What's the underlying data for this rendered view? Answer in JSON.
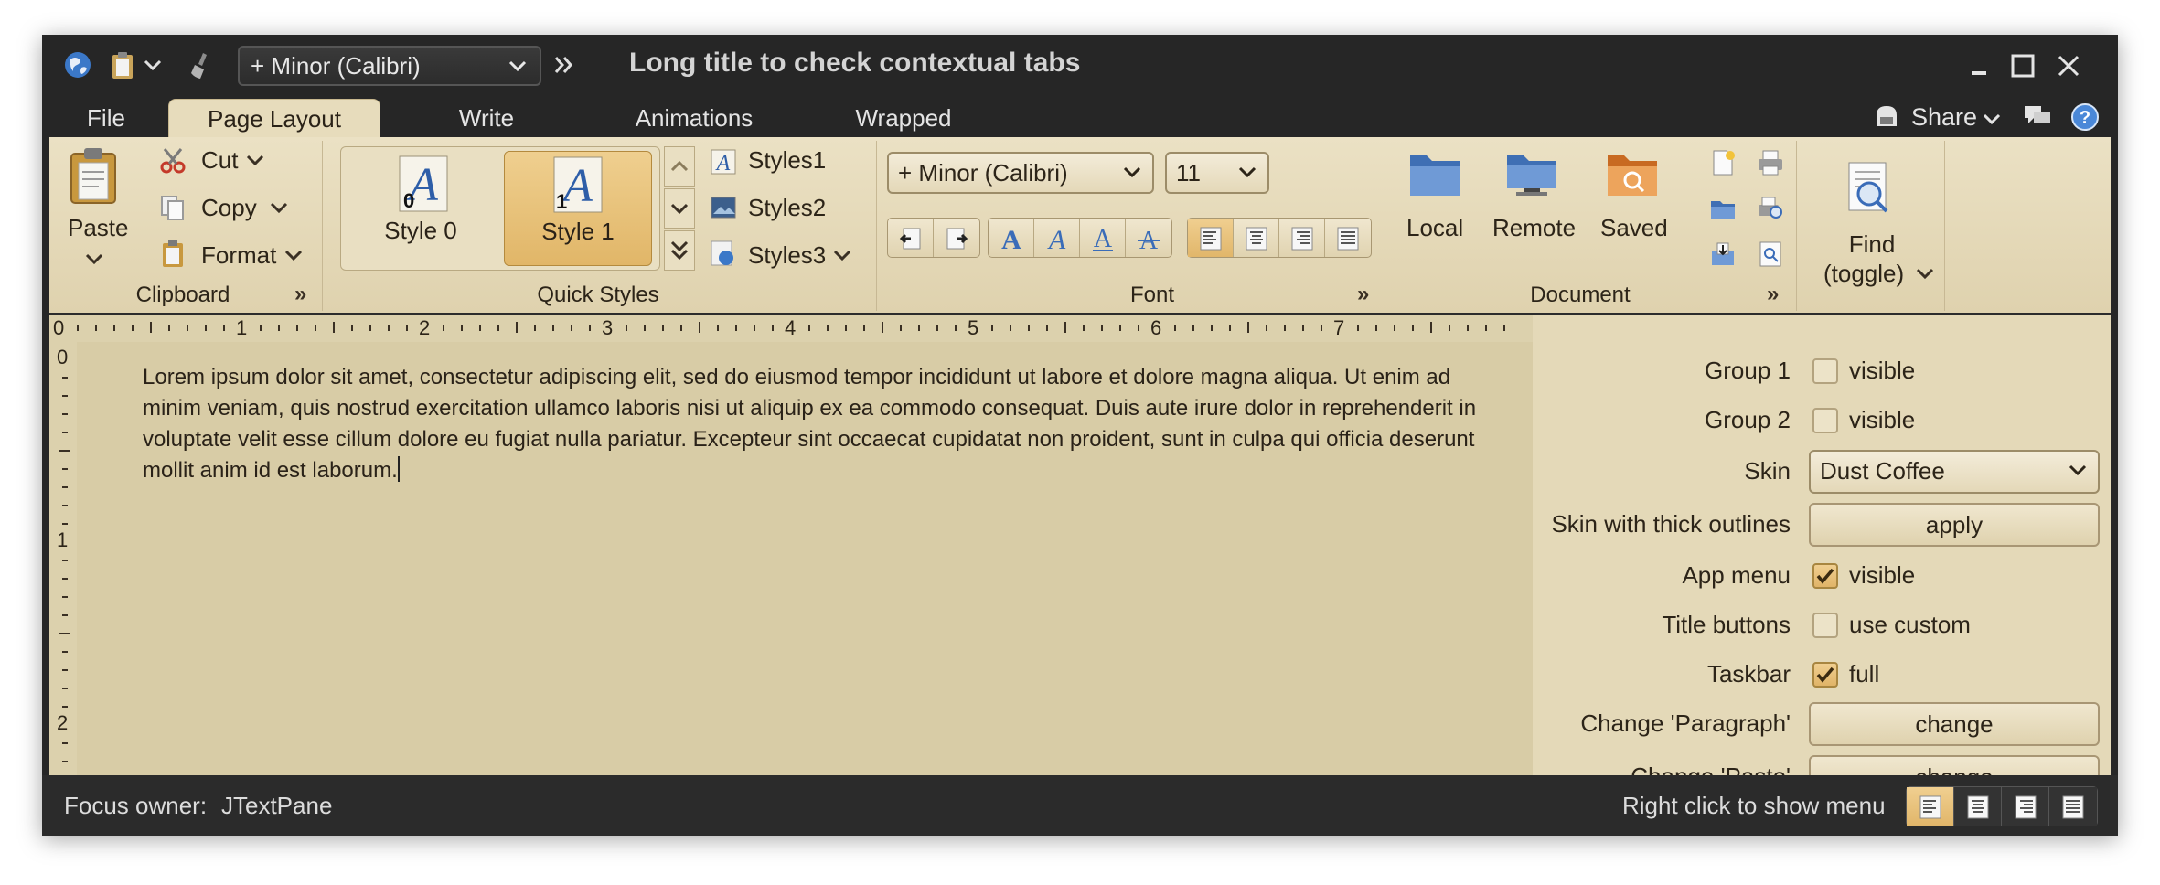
{
  "title_bar": {
    "font_combo": "+ Minor (Calibri)",
    "title": "Long title to check contextual tabs"
  },
  "tabs": [
    {
      "label": "File"
    },
    {
      "label": "Page Layout"
    },
    {
      "label": "Write"
    },
    {
      "label": "Animations"
    },
    {
      "label": "Wrapped"
    }
  ],
  "share_label": "Share",
  "ribbon": {
    "clipboard": {
      "title": "Clipboard",
      "paste": "Paste",
      "cut": "Cut",
      "copy": "Copy",
      "format": "Format"
    },
    "quick_styles": {
      "title": "Quick Styles",
      "style0": "Style 0",
      "style0_num": "0",
      "style1": "Style 1",
      "style1_num": "1",
      "styles1": "Styles1",
      "styles2": "Styles2",
      "styles3": "Styles3"
    },
    "font": {
      "title": "Font",
      "family": "+ Minor (Calibri)",
      "size": "11"
    },
    "document": {
      "title": "Document",
      "local": "Local",
      "remote": "Remote",
      "saved": "Saved"
    },
    "find": {
      "line1": "Find",
      "line2": "(toggle)"
    }
  },
  "ruler": {
    "h_labels": [
      "0",
      "1",
      "2",
      "3",
      "4",
      "5",
      "6",
      "7"
    ],
    "v_labels": [
      "0",
      "1",
      "2"
    ]
  },
  "editor": {
    "text": "Lorem ipsum dolor sit amet, consectetur adipiscing elit, sed do eiusmod tempor incididunt ut labore et dolore magna aliqua. Ut enim ad minim veniam, quis nostrud exercitation ullamco laboris nisi ut aliquip ex ea commodo consequat. Duis aute irure dolor in reprehenderit in voluptate velit esse cillum dolore eu fugiat nulla pariatur. Excepteur sint occaecat cupidatat non proident, sunt in culpa qui officia deserunt mollit anim id est laborum."
  },
  "panel": {
    "group1": {
      "label": "Group 1",
      "text": "visible",
      "checked": false
    },
    "group2": {
      "label": "Group 2",
      "text": "visible",
      "checked": false
    },
    "skin": {
      "label": "Skin",
      "value": "Dust Coffee"
    },
    "thick": {
      "label": "Skin with thick outlines",
      "button": "apply"
    },
    "app_menu": {
      "label": "App menu",
      "text": "visible",
      "checked": true
    },
    "title_buttons": {
      "label": "Title buttons",
      "text": "use custom",
      "checked": false
    },
    "taskbar": {
      "label": "Taskbar",
      "text": "full",
      "checked": true
    },
    "change_paragraph": {
      "label": "Change 'Paragraph'",
      "button": "change"
    },
    "change_paste": {
      "label": "Change 'Paste'",
      "button": "change"
    }
  },
  "status": {
    "focus_label": "Focus owner:",
    "focus_value": "JTextPane",
    "hint": "Right click to show menu"
  },
  "colors": {
    "ribbon_bg": "#e7dcbc",
    "accent": "#e1b66a",
    "frame": "#262626",
    "editor_bg": "#d8cca6"
  }
}
